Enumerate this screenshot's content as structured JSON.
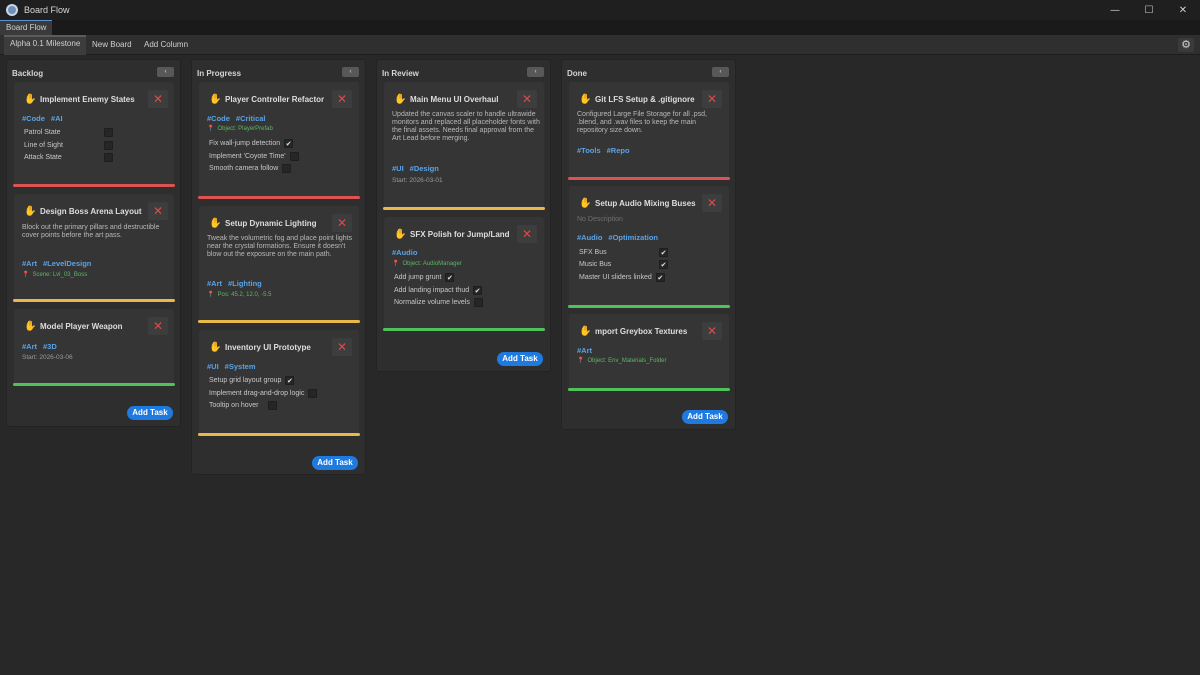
{
  "window": {
    "title": "Board Flow",
    "controls": [
      "—",
      "☐",
      "✕"
    ]
  },
  "doc_tab": "Board Flow",
  "toolbar": {
    "board_tab": "Alpha 0.1 Milestone",
    "new_board": "New Board",
    "add_column": "Add Column"
  },
  "colors": {
    "red": "#e05252",
    "yellow": "#e8b84a",
    "green": "#4fc25a",
    "tag": "#5aa2e6",
    "accent_button": "#1f7ae0"
  },
  "collapse_glyph": "‹",
  "add_task_label": "Add Task",
  "columns": [
    {
      "title": "Backlog",
      "cards": [
        {
          "title": "Implement Enemy States",
          "tags": [
            "#Code",
            "#AI"
          ],
          "subtasks": [
            {
              "label": "Patrol State",
              "checked": false
            },
            {
              "label": "Line of Sight",
              "checked": false
            },
            {
              "label": "Attack State",
              "checked": false
            }
          ],
          "priority": "red"
        },
        {
          "title": "Design Boss Arena Layout",
          "description": "Block out the primary pillars and destructible cover points before the art pass.",
          "tags": [
            "#Art",
            "#LevelDesign"
          ],
          "meta": "Scene: Lvl_03_Boss",
          "priority": "yellow"
        },
        {
          "title": "Model Player Weapon",
          "tags": [
            "#Art",
            "#3D"
          ],
          "start": "Start: 2026-03-06",
          "priority": "green"
        }
      ]
    },
    {
      "title": "In Progress",
      "cards": [
        {
          "title": "Player Controller Refactor",
          "tags": [
            "#Code",
            "#Critical"
          ],
          "meta": "Object: PlayerPrefab",
          "subtasks": [
            {
              "label": "Fix wall-jump detection",
              "checked": true
            },
            {
              "label": "Implement 'Coyote Time'",
              "checked": false
            },
            {
              "label": "Smooth camera follow",
              "checked": false
            }
          ],
          "priority": "red"
        },
        {
          "title": "Setup Dynamic Lighting",
          "description": "Tweak the volumetric fog and place point lights near the crystal formations. Ensure it doesn't blow out the exposure on the main path.",
          "tags": [
            "#Art",
            "#Lighting"
          ],
          "meta": "Pos: 45.2, 12.0, -5.5",
          "priority": "yellow"
        },
        {
          "title": "Inventory UI Prototype",
          "tags": [
            "#UI",
            "#System"
          ],
          "subtasks": [
            {
              "label": "Setup grid layout group",
              "checked": true
            },
            {
              "label": "Implement drag-and-drop logic",
              "checked": false
            },
            {
              "label": "Tooltip on hover",
              "checked": false
            }
          ],
          "priority": "yellow"
        }
      ]
    },
    {
      "title": "In Review",
      "cards": [
        {
          "title": "Main Menu UI Overhaul",
          "description": "Updated the canvas scaler to handle ultrawide monitors and replaced all placeholder fonts with the final assets. Needs final approval from the Art Lead before merging.",
          "tags": [
            "#UI",
            "#Design"
          ],
          "start": "Start: 2026-03-01",
          "priority": "yellow"
        },
        {
          "title": "SFX Polish for Jump/Land",
          "tags": [
            "#Audio"
          ],
          "meta": "Object: AudioManager",
          "subtasks": [
            {
              "label": "Add jump grunt",
              "checked": true
            },
            {
              "label": "Add landing impact thud",
              "checked": true
            },
            {
              "label": "Normalize volume levels",
              "checked": false
            }
          ],
          "priority": "green"
        }
      ]
    },
    {
      "title": "Done",
      "cards": [
        {
          "title": "Git LFS Setup & .gitignore",
          "description": "Configured Large File Storage for all .psd, .blend, and .wav files to keep the main repository size down.",
          "tags": [
            "#Tools",
            "#Repo"
          ],
          "priority": "red"
        },
        {
          "title": "Setup Audio Mixing Buses",
          "description": "No Description",
          "tags": [
            "#Audio",
            "#Optimization"
          ],
          "subtasks": [
            {
              "label": "SFX Bus",
              "checked": true
            },
            {
              "label": "Music Bus",
              "checked": true
            },
            {
              "label": "Master UI sliders linked",
              "checked": true
            }
          ],
          "priority": "green"
        },
        {
          "title": "mport Greybox Textures",
          "tags": [
            "#Art"
          ],
          "meta": "Object: Env_Materials_Folder",
          "priority": "green"
        }
      ]
    }
  ]
}
